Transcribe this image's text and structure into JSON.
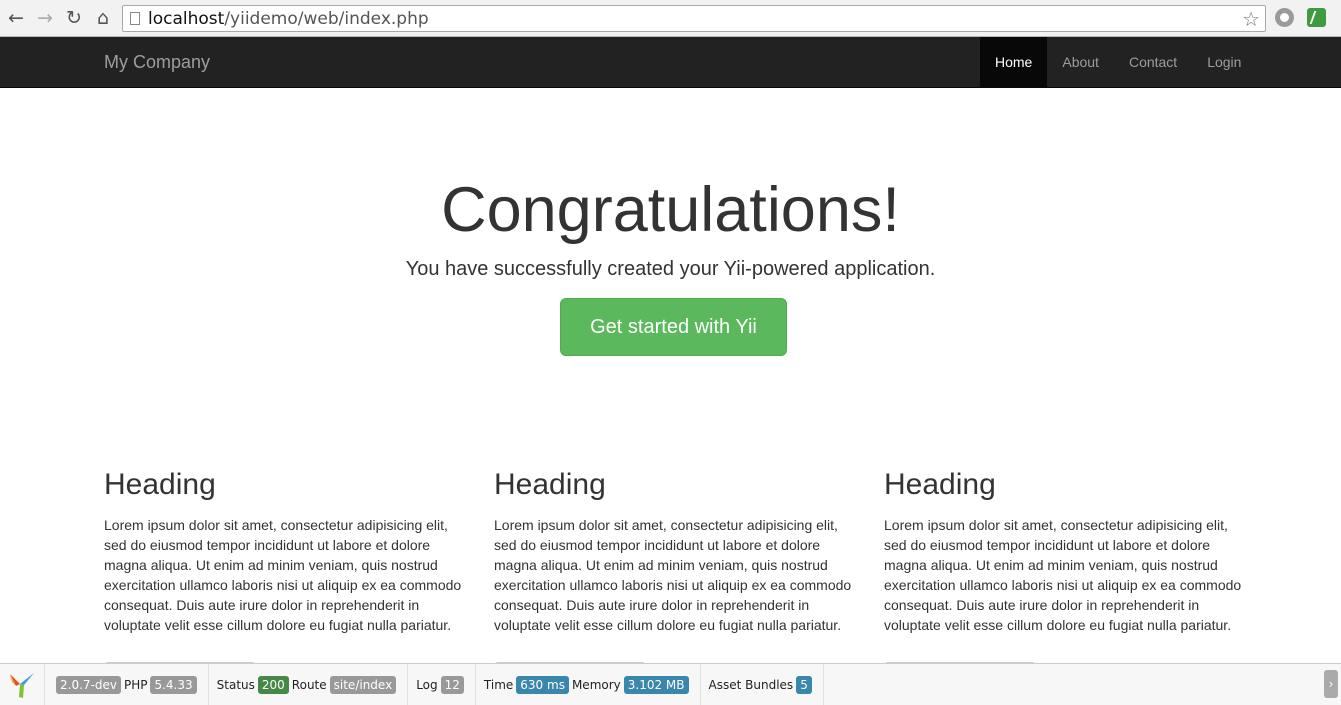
{
  "browser": {
    "url_host": "localhost",
    "url_path": "/yiidemo/web/index.php",
    "back_icon": "←",
    "forward_icon": "→",
    "reload_icon": "↻",
    "home_icon": "⌂",
    "star_icon": "☆"
  },
  "navbar": {
    "brand": "My Company",
    "items": [
      {
        "label": "Home",
        "active": true
      },
      {
        "label": "About",
        "active": false
      },
      {
        "label": "Contact",
        "active": false
      },
      {
        "label": "Login",
        "active": false
      }
    ]
  },
  "jumbotron": {
    "title": "Congratulations!",
    "lead": "You have successfully created your Yii-powered application.",
    "button": "Get started with Yii"
  },
  "columns": [
    {
      "heading": "Heading",
      "text": "Lorem ipsum dolor sit amet, consectetur adipisicing elit, sed do eiusmod tempor incididunt ut labore et dolore magna aliqua. Ut enim ad minim veniam, quis nostrud exercitation ullamco laboris nisi ut aliquip ex ea commodo consequat. Duis aute irure dolor in reprehenderit in voluptate velit esse cillum dolore eu fugiat nulla pariatur."
    },
    {
      "heading": "Heading",
      "text": "Lorem ipsum dolor sit amet, consectetur adipisicing elit, sed do eiusmod tempor incididunt ut labore et dolore magna aliqua. Ut enim ad minim veniam, quis nostrud exercitation ullamco laboris nisi ut aliquip ex ea commodo consequat. Duis aute irure dolor in reprehenderit in voluptate velit esse cillum dolore eu fugiat nulla pariatur."
    },
    {
      "heading": "Heading",
      "text": "Lorem ipsum dolor sit amet, consectetur adipisicing elit, sed do eiusmod tempor incididunt ut labore et dolore magna aliqua. Ut enim ad minim veniam, quis nostrud exercitation ullamco laboris nisi ut aliquip ex ea commodo consequat. Duis aute irure dolor in reprehenderit in voluptate velit esse cillum dolore eu fugiat nulla pariatur."
    }
  ],
  "debug": {
    "version": "2.0.7-dev",
    "php_label": "PHP",
    "php_version": "5.4.33",
    "status_label": "Status",
    "status_code": "200",
    "route_label": "Route",
    "route": "site/index",
    "log_label": "Log",
    "log_count": "12",
    "time_label": "Time",
    "time": "630 ms",
    "memory_label": "Memory",
    "memory": "3.102 MB",
    "assets_label": "Asset Bundles",
    "assets_count": "5",
    "collapse_icon": "›"
  },
  "colors": {
    "navbar_bg": "#222222",
    "success": "#5cb85c",
    "label_info": "#3a87ad",
    "label_success": "#468847"
  }
}
